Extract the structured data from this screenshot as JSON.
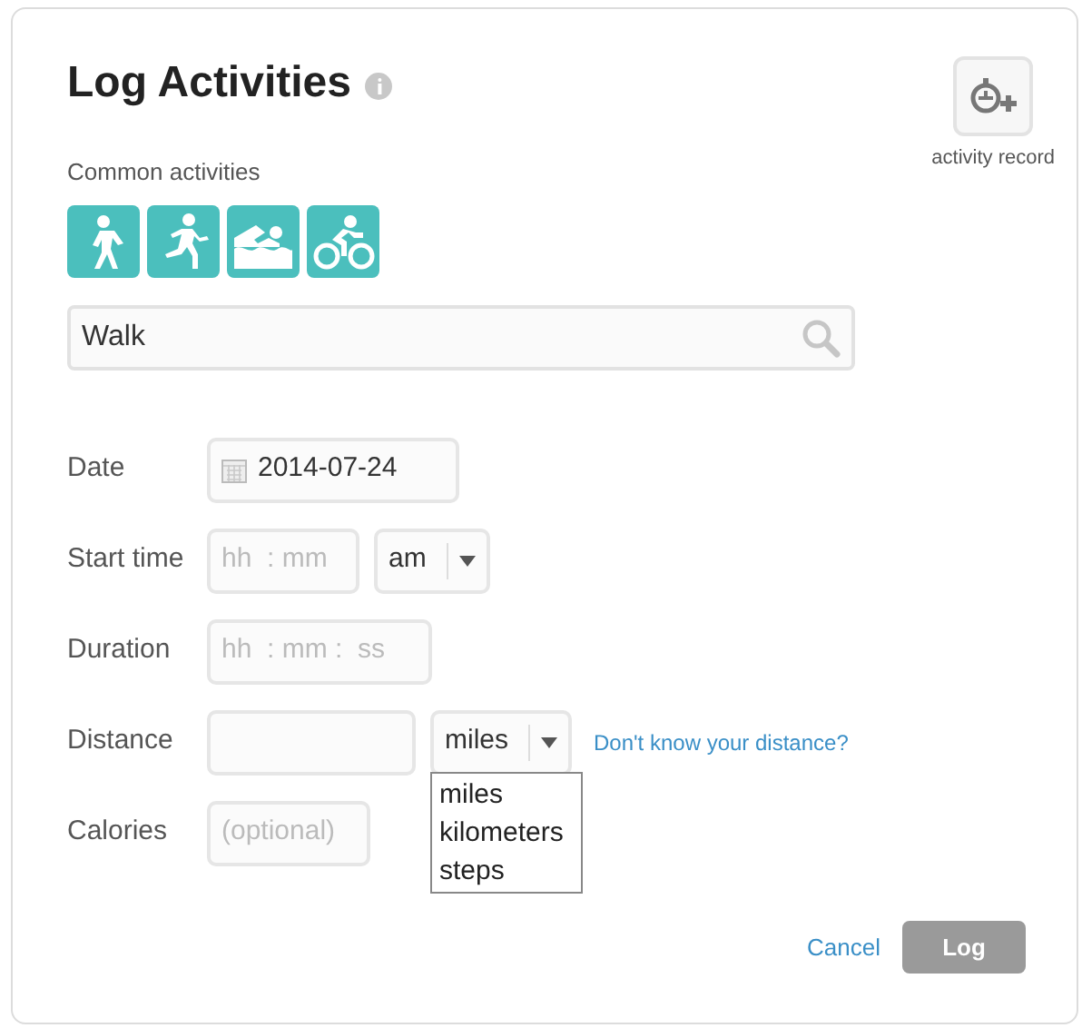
{
  "title": "Log Activities",
  "activity_record": {
    "label": "activity record"
  },
  "common_activities": {
    "label": "Common activities",
    "items": [
      {
        "kind": "walk"
      },
      {
        "kind": "run"
      },
      {
        "kind": "swim"
      },
      {
        "kind": "bike"
      }
    ]
  },
  "search": {
    "value": "Walk"
  },
  "form": [
    {
      "kind": "date",
      "label": "Date",
      "value": "2014-07-24"
    },
    {
      "kind": "start_time",
      "label": "Start time",
      "placeholder": "hh  : mm",
      "period": "am"
    },
    {
      "kind": "duration",
      "label": "Duration",
      "placeholder": "hh  : mm :  ss"
    },
    {
      "kind": "distance",
      "label": "Distance",
      "unit": "miles",
      "link": "Don't know your distance?",
      "unit_options": [
        "miles",
        "kilometers",
        "steps"
      ]
    },
    {
      "kind": "calories",
      "label": "Calories",
      "placeholder": "(optional)"
    }
  ],
  "buttons": {
    "cancel": "Cancel",
    "submit": "Log"
  }
}
